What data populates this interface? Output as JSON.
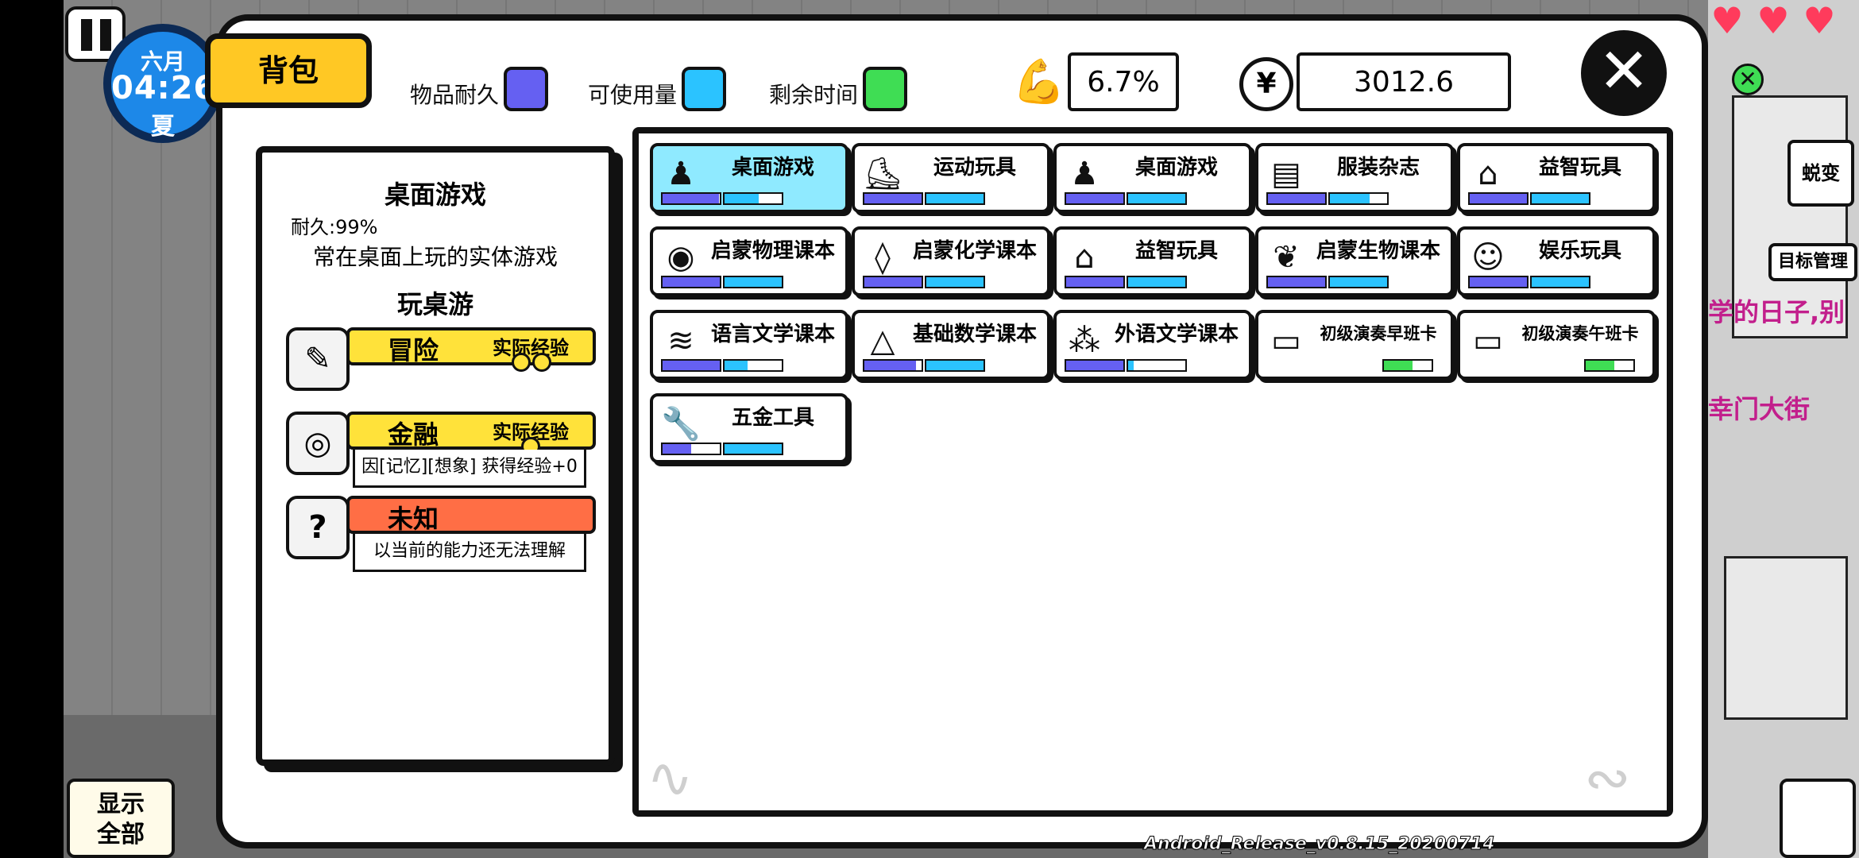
{
  "hud": {
    "month": "六月",
    "time": "04:26",
    "season": "夏",
    "show_all": [
      "显示",
      "全部"
    ],
    "side_buttons": {
      "transform": "蜕变",
      "goal_manage": "目标管理"
    },
    "side_texts": [
      "学的日子,别",
      "幸门大街"
    ],
    "version": "Android_Release_v0.8.15_20200714"
  },
  "header": {
    "bag_label": "背包",
    "legend": [
      {
        "label": "物品耐久",
        "color": "#6560f2"
      },
      {
        "label": "可使用量",
        "color": "#2bc3ff"
      },
      {
        "label": "剩余时间",
        "color": "#3fdd54"
      }
    ],
    "strength_value": "6.7%",
    "coin_symbol": "¥",
    "money_value": "3012.6",
    "close_symbol": "✕"
  },
  "colors": {
    "durability": "#6560f2",
    "usage": "#2bc3ff",
    "time": "#3fdd54",
    "accent": "#ffc824",
    "unknown": "#ff6e45",
    "selected": "#8feaff"
  },
  "detail": {
    "title": "桌面游戏",
    "durability": "耐久:99%",
    "description": "常在桌面上玩的实体游戏",
    "usage": "玩桌游",
    "skills": [
      {
        "name": "冒险",
        "tag": "实际经验",
        "color": "#ffe23a",
        "icon": "map-icon",
        "glyph": "✎",
        "note": ""
      },
      {
        "name": "金融",
        "tag": "实际经验",
        "color": "#ffe23a",
        "icon": "coins-icon",
        "glyph": "◎",
        "note": "因[记忆][想象] 获得经验+0"
      },
      {
        "name": "未知",
        "tag": "",
        "color": "#ff6e45",
        "icon": "question-icon",
        "glyph": "?",
        "note": "以当前的能力还无法理解"
      }
    ]
  },
  "inventory": [
    {
      "name": "桌面游戏",
      "icon": "board-game-icon",
      "glyph": "♟",
      "selected": true,
      "bars": [
        {
          "type": "durability",
          "value": 0.99
        },
        {
          "type": "usage",
          "value": 0.6
        }
      ]
    },
    {
      "name": "运动玩具",
      "icon": "skates-icon",
      "glyph": "⛸",
      "bars": [
        {
          "type": "durability",
          "value": 1.0
        },
        {
          "type": "usage",
          "value": 1.0
        }
      ]
    },
    {
      "name": "桌面游戏",
      "icon": "board-game-icon",
      "glyph": "♟",
      "bars": [
        {
          "type": "durability",
          "value": 1.0
        },
        {
          "type": "usage",
          "value": 1.0
        }
      ]
    },
    {
      "name": "服装杂志",
      "icon": "magazine-icon",
      "glyph": "▤",
      "bars": [
        {
          "type": "durability",
          "value": 1.0
        },
        {
          "type": "usage",
          "value": 0.7
        }
      ]
    },
    {
      "name": "益智玩具",
      "icon": "house-toy-icon",
      "glyph": "⌂",
      "bars": [
        {
          "type": "durability",
          "value": 1.0
        },
        {
          "type": "usage",
          "value": 1.0
        }
      ]
    },
    {
      "name": "启蒙物理课本",
      "icon": "physics-book-icon",
      "glyph": "◉",
      "bars": [
        {
          "type": "durability",
          "value": 1.0
        },
        {
          "type": "usage",
          "value": 1.0
        }
      ]
    },
    {
      "name": "启蒙化学课本",
      "icon": "chemistry-book-icon",
      "glyph": "◊",
      "bars": [
        {
          "type": "durability",
          "value": 1.0
        },
        {
          "type": "usage",
          "value": 1.0
        }
      ]
    },
    {
      "name": "益智玩具",
      "icon": "house-toy-icon",
      "glyph": "⌂",
      "bars": [
        {
          "type": "durability",
          "value": 1.0
        },
        {
          "type": "usage",
          "value": 1.0
        }
      ]
    },
    {
      "name": "启蒙生物课本",
      "icon": "biology-book-icon",
      "glyph": "❦",
      "bars": [
        {
          "type": "durability",
          "value": 1.0
        },
        {
          "type": "usage",
          "value": 1.0
        }
      ]
    },
    {
      "name": "娱乐玩具",
      "icon": "robot-toy-icon",
      "glyph": "☺",
      "bars": [
        {
          "type": "durability",
          "value": 1.0
        },
        {
          "type": "usage",
          "value": 1.0
        }
      ]
    },
    {
      "name": "语言文学课本",
      "icon": "literature-book-icon",
      "glyph": "≋",
      "bars": [
        {
          "type": "durability",
          "value": 1.0
        },
        {
          "type": "usage",
          "value": 0.4
        }
      ]
    },
    {
      "name": "基础数学课本",
      "icon": "math-book-icon",
      "glyph": "△",
      "bars": [
        {
          "type": "durability",
          "value": 0.9
        },
        {
          "type": "usage",
          "value": 1.0
        }
      ]
    },
    {
      "name": "外语文学课本",
      "icon": "foreign-book-icon",
      "glyph": "⁂",
      "bars": [
        {
          "type": "durability",
          "value": 1.0
        },
        {
          "type": "usage",
          "value": 0.1
        }
      ]
    },
    {
      "name": "初级演奏早班卡",
      "icon": "ticket-card-icon",
      "glyph": "▭",
      "small": true,
      "bars": [
        {
          "type": "time",
          "value": 0.6
        }
      ]
    },
    {
      "name": "初级演奏午班卡",
      "icon": "ticket-card-icon",
      "glyph": "▭",
      "small": true,
      "bars": [
        {
          "type": "time",
          "value": 0.6
        }
      ]
    },
    {
      "name": "五金工具",
      "icon": "wrench-icon",
      "glyph": "🔧",
      "bars": [
        {
          "type": "durability",
          "value": 0.5
        },
        {
          "type": "usage",
          "value": 1.0
        }
      ]
    }
  ]
}
